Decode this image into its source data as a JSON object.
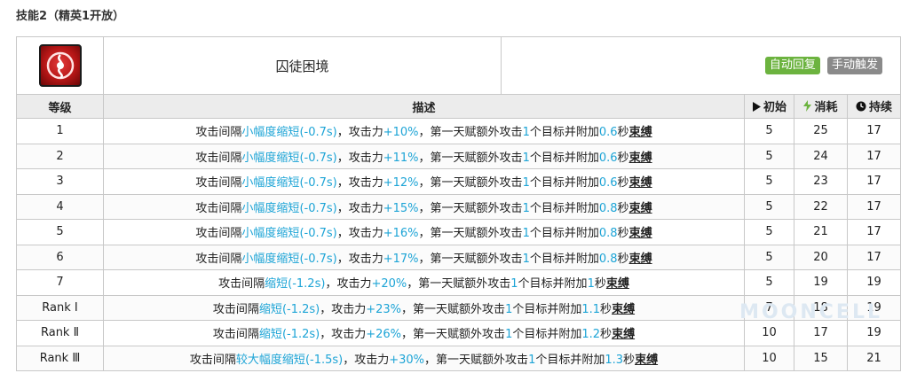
{
  "page_title": "技能2（精英1开放）",
  "skill": {
    "name": "囚徒困境",
    "icon": "red-knot-skill-icon",
    "tags": [
      {
        "label": "自动回复",
        "color": "#6cb33f"
      },
      {
        "label": "手动触发",
        "color": "#8a8a8a"
      }
    ]
  },
  "columns": {
    "level": "等级",
    "description": "描述",
    "initial": "初始",
    "cost": "消耗",
    "duration": "持续"
  },
  "rows": [
    {
      "level": "1",
      "pre": "攻击间隔",
      "interval_adj": "小幅度缩短",
      "interval_val": "(-0.7s)",
      "mid1": "，攻击力",
      "atk": "+10%",
      "mid2": "，第一天赋额外攻击",
      "targets": "1",
      "mid3": "个目标并附加",
      "bind_sec": "0.6",
      "mid4": "秒",
      "keyword": "束缚",
      "initial": "5",
      "cost": "25",
      "duration": "17"
    },
    {
      "level": "2",
      "pre": "攻击间隔",
      "interval_adj": "小幅度缩短",
      "interval_val": "(-0.7s)",
      "mid1": "，攻击力",
      "atk": "+11%",
      "mid2": "，第一天赋额外攻击",
      "targets": "1",
      "mid3": "个目标并附加",
      "bind_sec": "0.6",
      "mid4": "秒",
      "keyword": "束缚",
      "initial": "5",
      "cost": "24",
      "duration": "17"
    },
    {
      "level": "3",
      "pre": "攻击间隔",
      "interval_adj": "小幅度缩短",
      "interval_val": "(-0.7s)",
      "mid1": "，攻击力",
      "atk": "+12%",
      "mid2": "，第一天赋额外攻击",
      "targets": "1",
      "mid3": "个目标并附加",
      "bind_sec": "0.6",
      "mid4": "秒",
      "keyword": "束缚",
      "initial": "5",
      "cost": "23",
      "duration": "17"
    },
    {
      "level": "4",
      "pre": "攻击间隔",
      "interval_adj": "小幅度缩短",
      "interval_val": "(-0.7s)",
      "mid1": "，攻击力",
      "atk": "+15%",
      "mid2": "，第一天赋额外攻击",
      "targets": "1",
      "mid3": "个目标并附加",
      "bind_sec": "0.8",
      "mid4": "秒",
      "keyword": "束缚",
      "initial": "5",
      "cost": "22",
      "duration": "17"
    },
    {
      "level": "5",
      "pre": "攻击间隔",
      "interval_adj": "小幅度缩短",
      "interval_val": "(-0.7s)",
      "mid1": "，攻击力",
      "atk": "+16%",
      "mid2": "，第一天赋额外攻击",
      "targets": "1",
      "mid3": "个目标并附加",
      "bind_sec": "0.8",
      "mid4": "秒",
      "keyword": "束缚",
      "initial": "5",
      "cost": "21",
      "duration": "17"
    },
    {
      "level": "6",
      "pre": "攻击间隔",
      "interval_adj": "小幅度缩短",
      "interval_val": "(-0.7s)",
      "mid1": "，攻击力",
      "atk": "+17%",
      "mid2": "，第一天赋额外攻击",
      "targets": "1",
      "mid3": "个目标并附加",
      "bind_sec": "0.8",
      "mid4": "秒",
      "keyword": "束缚",
      "initial": "5",
      "cost": "20",
      "duration": "17"
    },
    {
      "level": "7",
      "pre": "攻击间隔",
      "interval_adj": "缩短",
      "interval_val": "(-1.2s)",
      "mid1": "，攻击力",
      "atk": "+20%",
      "mid2": "，第一天赋额外攻击",
      "targets": "1",
      "mid3": "个目标并附加",
      "bind_sec": "1",
      "mid4": "秒",
      "keyword": "束缚",
      "initial": "5",
      "cost": "19",
      "duration": "19"
    },
    {
      "level": "Rank Ⅰ",
      "pre": "攻击间隔",
      "interval_adj": "缩短",
      "interval_val": "(-1.2s)",
      "mid1": "，攻击力",
      "atk": "+23%",
      "mid2": "，第一天赋额外攻击",
      "targets": "1",
      "mid3": "个目标并附加",
      "bind_sec": "1.1",
      "mid4": "秒",
      "keyword": "束缚",
      "initial": "7",
      "cost": "18",
      "duration": "19"
    },
    {
      "level": "Rank Ⅱ",
      "pre": "攻击间隔",
      "interval_adj": "缩短",
      "interval_val": "(-1.2s)",
      "mid1": "，攻击力",
      "atk": "+26%",
      "mid2": "，第一天赋额外攻击",
      "targets": "1",
      "mid3": "个目标并附加",
      "bind_sec": "1.2",
      "mid4": "秒",
      "keyword": "束缚",
      "initial": "10",
      "cost": "17",
      "duration": "19"
    },
    {
      "level": "Rank Ⅲ",
      "pre": "攻击间隔",
      "interval_adj": "较大幅度缩短",
      "interval_val": "(-1.5s)",
      "mid1": "，攻击力",
      "atk": "+30%",
      "mid2": "，第一天赋额外攻击",
      "targets": "1",
      "mid3": "个目标并附加",
      "bind_sec": "1.3",
      "mid4": "秒",
      "keyword": "束缚",
      "initial": "10",
      "cost": "15",
      "duration": "21"
    }
  ],
  "watermark": "MOONCELL",
  "colors": {
    "highlight": "#1da4d6",
    "auto_recover": "#6cb33f",
    "manual": "#8a8a8a"
  }
}
